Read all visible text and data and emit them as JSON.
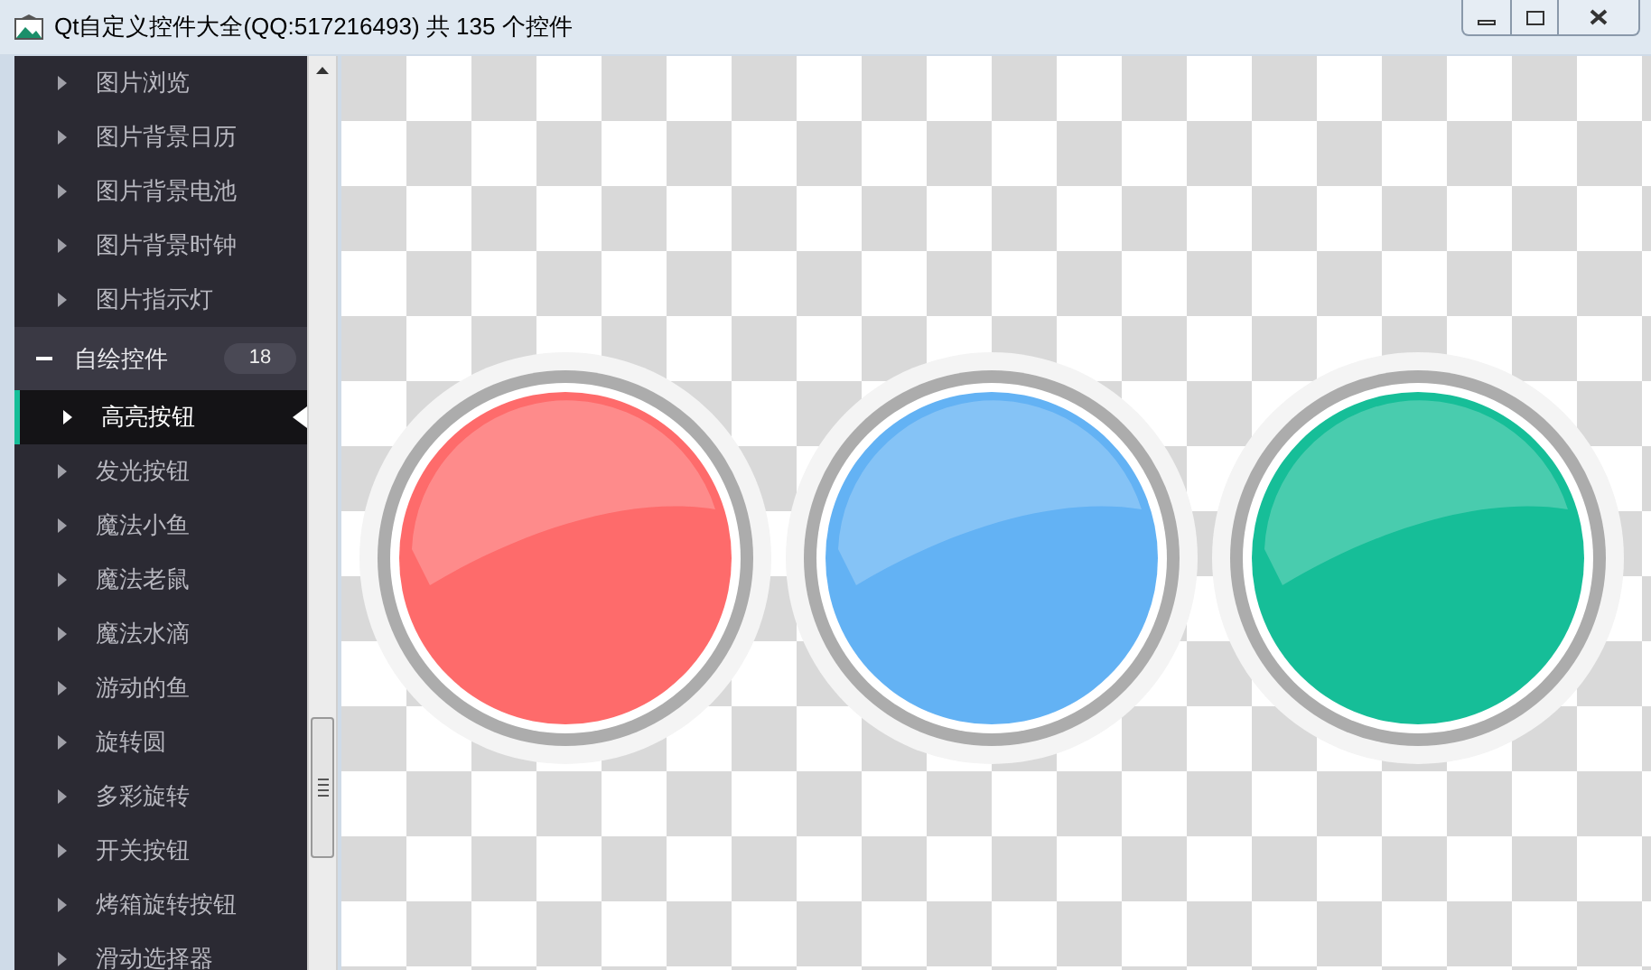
{
  "window": {
    "title": "Qt自定义控件大全(QQ:517216493) 共 135 个控件"
  },
  "sidebar": [
    {
      "kind": "item",
      "label": "图片浏览",
      "selected": false
    },
    {
      "kind": "item",
      "label": "图片背景日历",
      "selected": false
    },
    {
      "kind": "item",
      "label": "图片背景电池",
      "selected": false
    },
    {
      "kind": "item",
      "label": "图片背景时钟",
      "selected": false
    },
    {
      "kind": "item",
      "label": "图片指示灯",
      "selected": false
    },
    {
      "kind": "group",
      "label": "自绘控件",
      "count": "18",
      "expanded": true,
      "children": [
        {
          "label": "高亮按钮",
          "selected": true
        },
        {
          "label": "发光按钮",
          "selected": false
        },
        {
          "label": "魔法小鱼",
          "selected": false
        },
        {
          "label": "魔法老鼠",
          "selected": false
        },
        {
          "label": "魔法水滴",
          "selected": false
        },
        {
          "label": "游动的鱼",
          "selected": false
        },
        {
          "label": "旋转圆",
          "selected": false
        },
        {
          "label": "多彩旋转",
          "selected": false
        },
        {
          "label": "开关按钮",
          "selected": false
        },
        {
          "label": "烤箱旋转按钮",
          "selected": false
        },
        {
          "label": "滑动选择器",
          "selected": false
        }
      ]
    }
  ],
  "lights": [
    {
      "color": "#fe6b6b"
    },
    {
      "color": "#63b2f4"
    },
    {
      "color": "#16be98"
    }
  ]
}
